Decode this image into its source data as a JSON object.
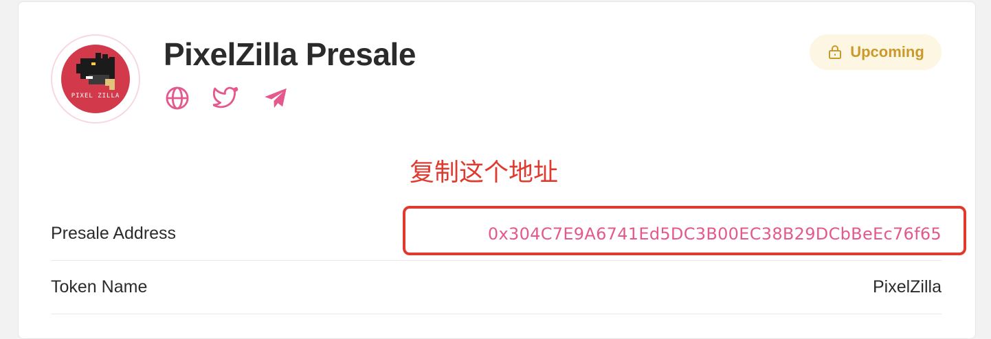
{
  "project": {
    "title": "PixelZilla Presale",
    "logo_text": "PIXEL ZILLA",
    "status": "Upcoming",
    "social": [
      "globe-icon",
      "twitter-icon",
      "telegram-icon"
    ]
  },
  "annotation": {
    "text": "复制这个地址"
  },
  "details": [
    {
      "label": "Presale Address",
      "value": "0x304C7E9A6741Ed5DC3B00EC38B29DCbBeEc76f65"
    },
    {
      "label": "Token Name",
      "value": "PixelZilla"
    }
  ],
  "colors": {
    "accent_pink": "#e5588e",
    "status_bg": "#fdf6e3",
    "status_text": "#c99a2a",
    "annotation_red": "#e03a2f",
    "logo_red": "#d23a4b"
  }
}
